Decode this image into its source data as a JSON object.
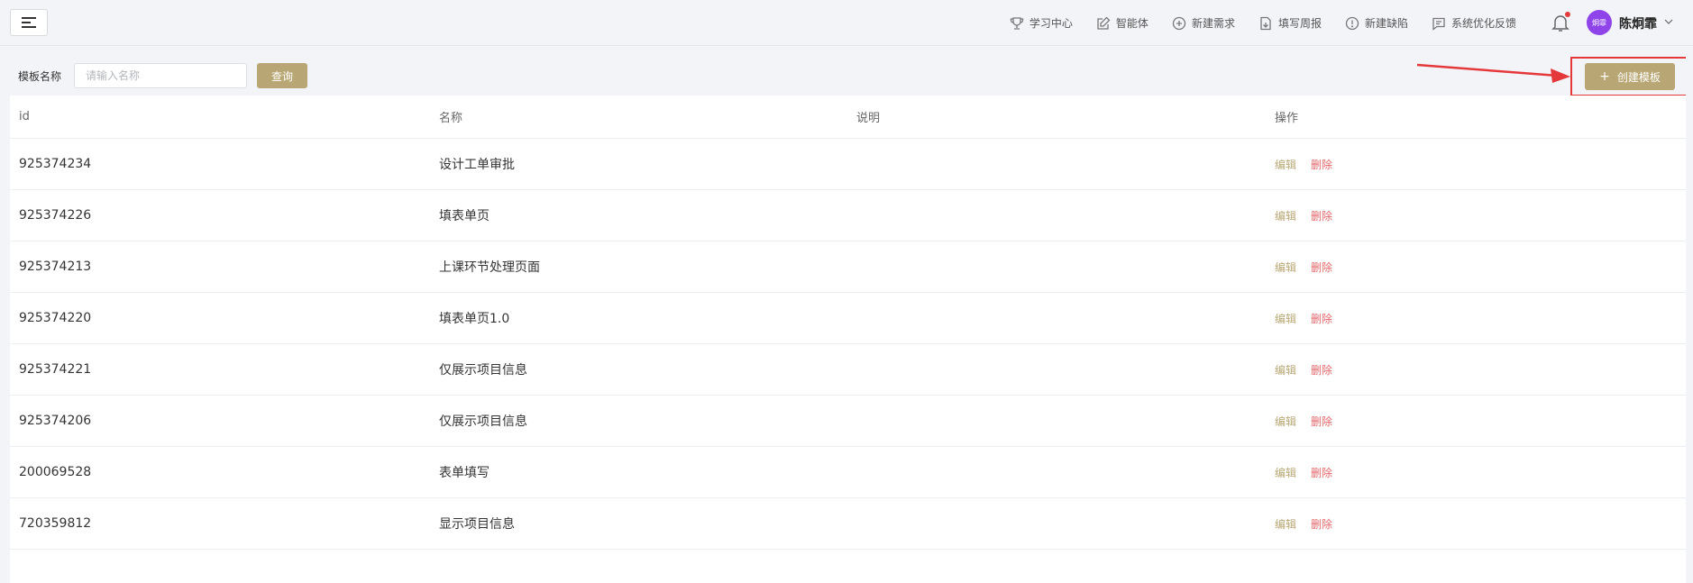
{
  "nav": {
    "items": [
      {
        "label": "学习中心",
        "icon": "trophy-icon"
      },
      {
        "label": "智能体",
        "icon": "edit-icon"
      },
      {
        "label": "新建需求",
        "icon": "plus-circle-icon"
      },
      {
        "label": "填写周报",
        "icon": "file-icon"
      },
      {
        "label": "新建缺陷",
        "icon": "alert-circle-icon"
      },
      {
        "label": "系统优化反馈",
        "icon": "message-icon"
      }
    ]
  },
  "user": {
    "avatar_text": "炯霏",
    "name": "陈炯霏"
  },
  "filter": {
    "label": "模板名称",
    "placeholder": "请输入名称",
    "value": "",
    "query_label": "查询"
  },
  "create": {
    "label": "创建模板"
  },
  "table": {
    "headers": {
      "id": "id",
      "name": "名称",
      "desc": "说明",
      "op": "操作"
    },
    "edit_label": "编辑",
    "delete_label": "删除",
    "rows": [
      {
        "id": "925374234",
        "name": "设计工单审批",
        "desc": ""
      },
      {
        "id": "925374226",
        "name": "填表单页",
        "desc": ""
      },
      {
        "id": "925374213",
        "name": "上课环节处理页面",
        "desc": ""
      },
      {
        "id": "925374220",
        "name": "填表单页1.0",
        "desc": ""
      },
      {
        "id": "925374221",
        "name": "仅展示项目信息",
        "desc": ""
      },
      {
        "id": "925374206",
        "name": "仅展示项目信息",
        "desc": ""
      },
      {
        "id": "200069528",
        "name": "表单填写",
        "desc": ""
      },
      {
        "id": "720359812",
        "name": "显示项目信息",
        "desc": ""
      }
    ]
  },
  "colors": {
    "accent": "#b8a774",
    "danger": "#e3676b",
    "highlight": "#e5383b",
    "avatar": "#8e44e8"
  }
}
